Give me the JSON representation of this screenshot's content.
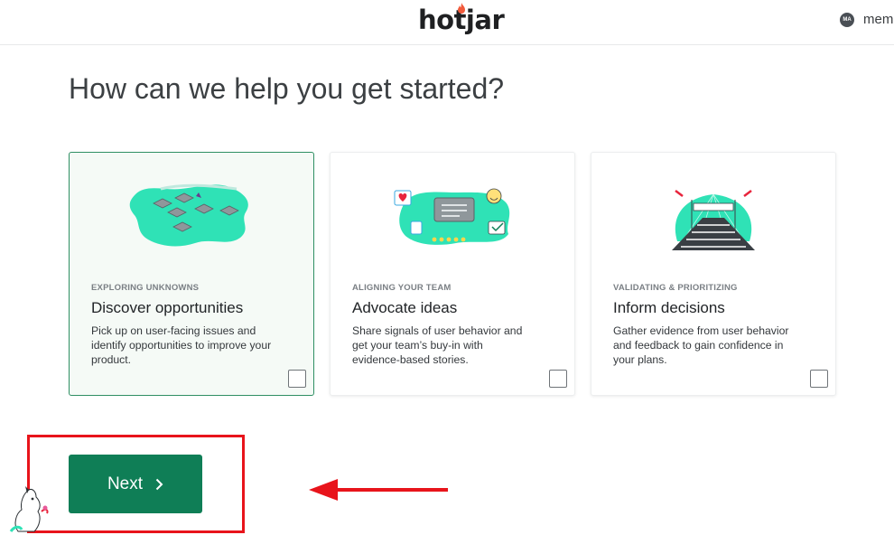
{
  "header": {
    "logo": "hotjar",
    "user_initials": "MA",
    "user_name": "mem"
  },
  "main": {
    "heading": "How can we help you get started?",
    "cards": [
      {
        "eyebrow": "EXPLORING UNKNOWNS",
        "title": "Discover opportunities",
        "description": "Pick up on user-facing issues and identify opportunities to improve your product.",
        "selected": true
      },
      {
        "eyebrow": "ALIGNING YOUR TEAM",
        "title": "Advocate ideas",
        "description": "Share signals of user behavior and get your team’s buy-in with evidence-based stories.",
        "selected": false
      },
      {
        "eyebrow": "VALIDATING & PRIORITIZING",
        "title": "Inform decisions",
        "description": "Gather evidence from user behavior and feedback to gain confidence in your plans.",
        "selected": false
      }
    ],
    "next_label": "Next"
  },
  "colors": {
    "brand_green": "#0f7e56",
    "teal_accent": "#2fe2b6",
    "annotation_red": "#e8141b"
  },
  "icons": [
    "flame-icon",
    "chevron-right-icon",
    "arrow-left-icon",
    "mascot-icon"
  ]
}
